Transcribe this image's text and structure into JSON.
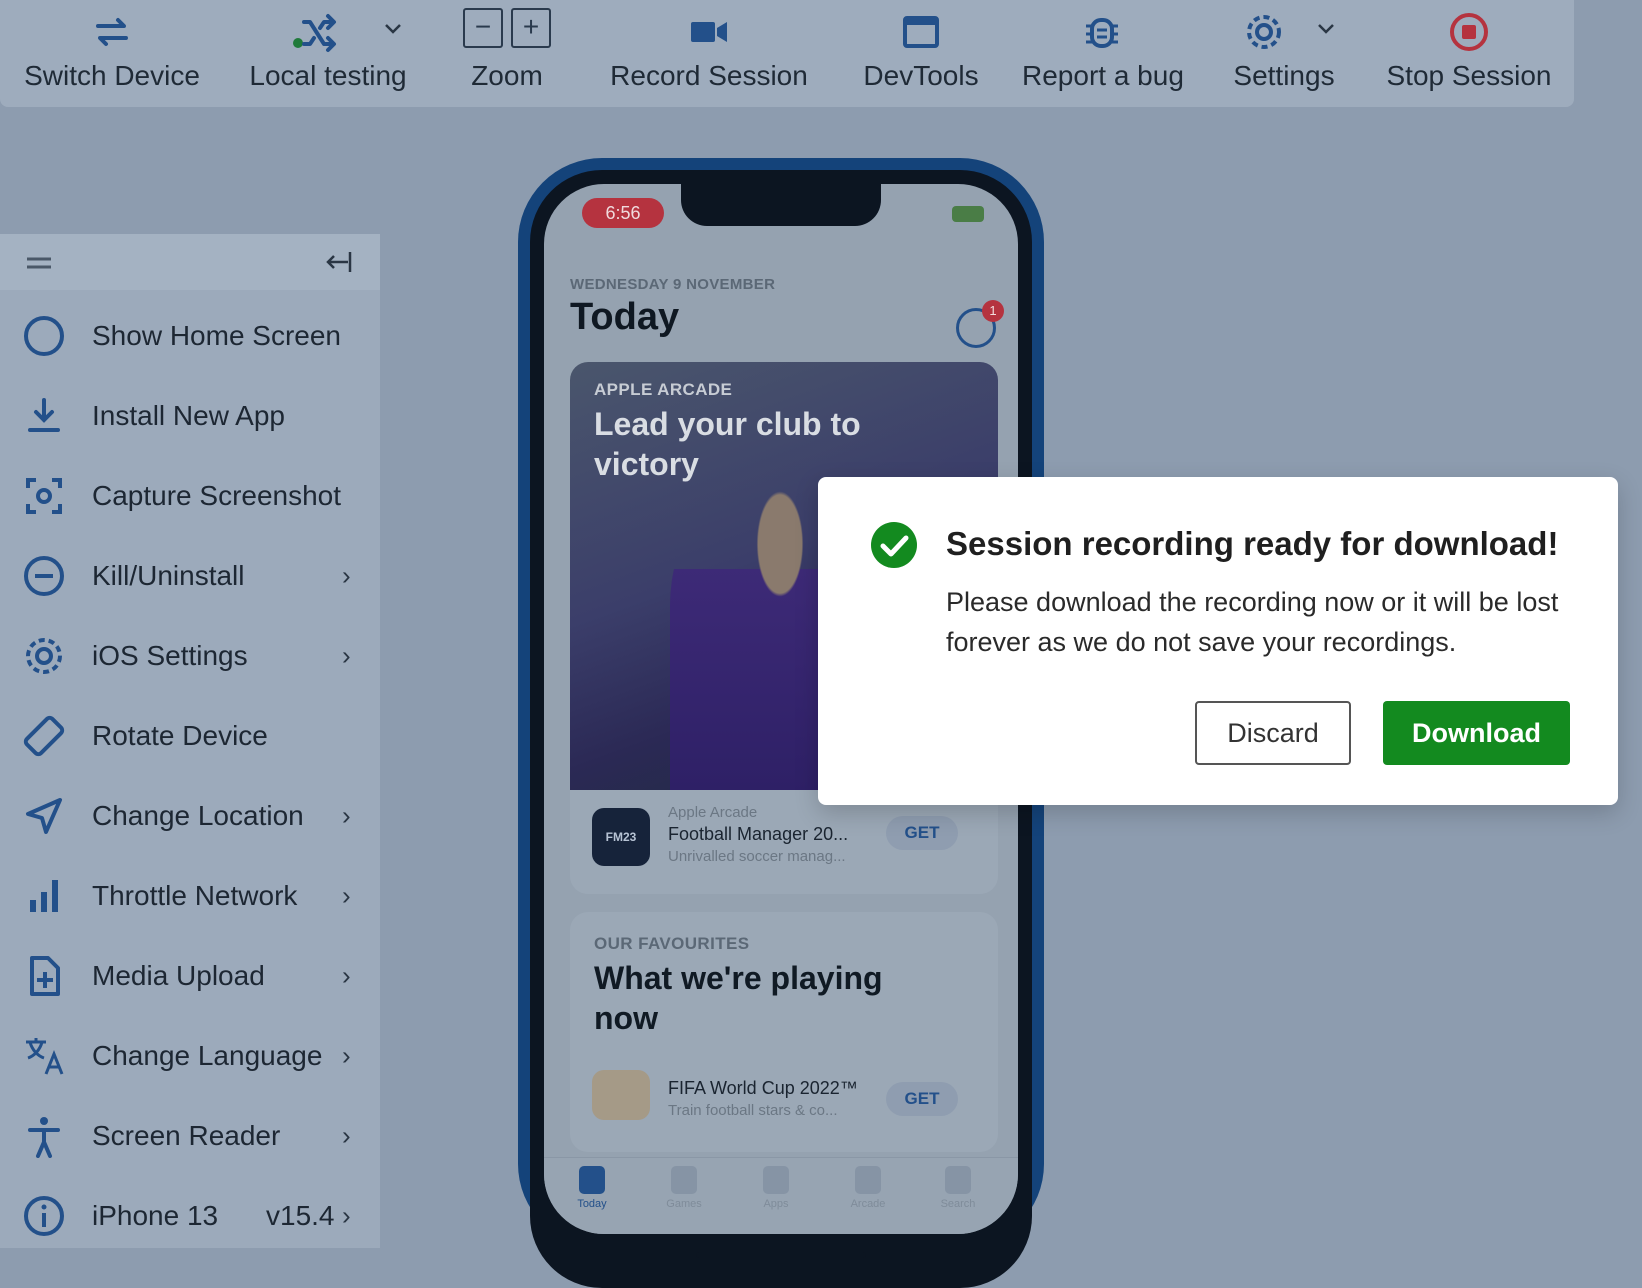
{
  "toolbar": {
    "switch_device": "Switch Device",
    "local_testing": "Local testing",
    "zoom": "Zoom",
    "record_session": "Record Session",
    "devtools": "DevTools",
    "report_bug": "Report a bug",
    "settings": "Settings",
    "stop_session": "Stop Session",
    "zoom_minus": "−",
    "zoom_plus": "+"
  },
  "sidebar": {
    "items": [
      {
        "label": "Show Home Screen",
        "icon": "circle-icon",
        "chevron": false
      },
      {
        "label": "Install New App",
        "icon": "download-icon",
        "chevron": false
      },
      {
        "label": "Capture Screenshot",
        "icon": "screenshot-icon",
        "chevron": false
      },
      {
        "label": "Kill/Uninstall",
        "icon": "minus-circle-icon",
        "chevron": true
      },
      {
        "label": "iOS Settings",
        "icon": "gear-icon",
        "chevron": true
      },
      {
        "label": "Rotate Device",
        "icon": "rotate-icon",
        "chevron": false
      },
      {
        "label": "Change Location",
        "icon": "location-arrow-icon",
        "chevron": true
      },
      {
        "label": "Throttle Network",
        "icon": "signal-bars-icon",
        "chevron": true
      },
      {
        "label": "Media Upload",
        "icon": "file-plus-icon",
        "chevron": true
      },
      {
        "label": "Change Language",
        "icon": "translate-icon",
        "chevron": true
      },
      {
        "label": "Screen Reader",
        "icon": "accessibility-icon",
        "chevron": true
      },
      {
        "label": "iPhone 13",
        "icon": "info-icon",
        "chevron": true,
        "version": "v15.4"
      }
    ],
    "chevron": "›"
  },
  "phone": {
    "time": "6:56",
    "date_caption": "WEDNESDAY 9 NOVEMBER",
    "title": "Today",
    "badge": "1",
    "card1": {
      "caption": "APPLE ARCADE",
      "headline": "Lead your club to victory",
      "app_icon_text": "FM23",
      "app_sub": "Apple Arcade",
      "app_name": "Football Manager 20...",
      "app_desc": "Unrivalled soccer manag...",
      "get": "GET"
    },
    "card2": {
      "caption": "OUR FAVOURITES",
      "headline": "What we're playing now",
      "app_name": "FIFA World Cup 2022™",
      "app_desc": "Train football stars & co...",
      "get": "GET"
    },
    "tabs": [
      "Today",
      "Games",
      "Apps",
      "Arcade",
      "Search"
    ]
  },
  "dialog": {
    "title": "Session recording ready for download!",
    "message": "Please download the recording now or it will be lost forever as we do not save your recordings.",
    "discard": "Discard",
    "download": "Download"
  },
  "colors": {
    "accent_blue": "#23508a",
    "success_green": "#138a1f",
    "stop_red": "#b5333f"
  }
}
